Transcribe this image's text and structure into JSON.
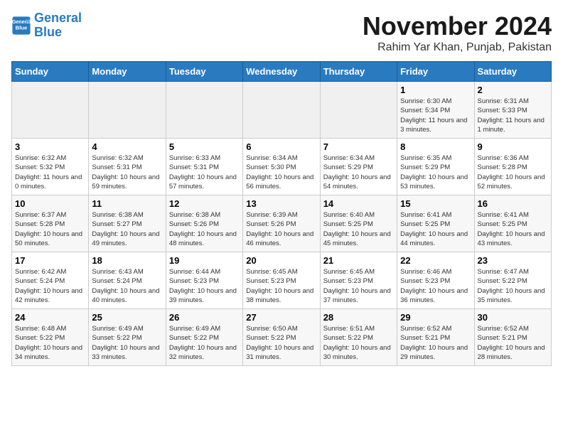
{
  "header": {
    "logo_line1": "General",
    "logo_line2": "Blue",
    "month_title": "November 2024",
    "location": "Rahim Yar Khan, Punjab, Pakistan"
  },
  "weekdays": [
    "Sunday",
    "Monday",
    "Tuesday",
    "Wednesday",
    "Thursday",
    "Friday",
    "Saturday"
  ],
  "weeks": [
    [
      {
        "day": "",
        "info": ""
      },
      {
        "day": "",
        "info": ""
      },
      {
        "day": "",
        "info": ""
      },
      {
        "day": "",
        "info": ""
      },
      {
        "day": "",
        "info": ""
      },
      {
        "day": "1",
        "info": "Sunrise: 6:30 AM\nSunset: 5:34 PM\nDaylight: 11 hours\nand 3 minutes."
      },
      {
        "day": "2",
        "info": "Sunrise: 6:31 AM\nSunset: 5:33 PM\nDaylight: 11 hours\nand 1 minute."
      }
    ],
    [
      {
        "day": "3",
        "info": "Sunrise: 6:32 AM\nSunset: 5:32 PM\nDaylight: 11 hours\nand 0 minutes."
      },
      {
        "day": "4",
        "info": "Sunrise: 6:32 AM\nSunset: 5:31 PM\nDaylight: 10 hours\nand 59 minutes."
      },
      {
        "day": "5",
        "info": "Sunrise: 6:33 AM\nSunset: 5:31 PM\nDaylight: 10 hours\nand 57 minutes."
      },
      {
        "day": "6",
        "info": "Sunrise: 6:34 AM\nSunset: 5:30 PM\nDaylight: 10 hours\nand 56 minutes."
      },
      {
        "day": "7",
        "info": "Sunrise: 6:34 AM\nSunset: 5:29 PM\nDaylight: 10 hours\nand 54 minutes."
      },
      {
        "day": "8",
        "info": "Sunrise: 6:35 AM\nSunset: 5:29 PM\nDaylight: 10 hours\nand 53 minutes."
      },
      {
        "day": "9",
        "info": "Sunrise: 6:36 AM\nSunset: 5:28 PM\nDaylight: 10 hours\nand 52 minutes."
      }
    ],
    [
      {
        "day": "10",
        "info": "Sunrise: 6:37 AM\nSunset: 5:28 PM\nDaylight: 10 hours\nand 50 minutes."
      },
      {
        "day": "11",
        "info": "Sunrise: 6:38 AM\nSunset: 5:27 PM\nDaylight: 10 hours\nand 49 minutes."
      },
      {
        "day": "12",
        "info": "Sunrise: 6:38 AM\nSunset: 5:26 PM\nDaylight: 10 hours\nand 48 minutes."
      },
      {
        "day": "13",
        "info": "Sunrise: 6:39 AM\nSunset: 5:26 PM\nDaylight: 10 hours\nand 46 minutes."
      },
      {
        "day": "14",
        "info": "Sunrise: 6:40 AM\nSunset: 5:25 PM\nDaylight: 10 hours\nand 45 minutes."
      },
      {
        "day": "15",
        "info": "Sunrise: 6:41 AM\nSunset: 5:25 PM\nDaylight: 10 hours\nand 44 minutes."
      },
      {
        "day": "16",
        "info": "Sunrise: 6:41 AM\nSunset: 5:25 PM\nDaylight: 10 hours\nand 43 minutes."
      }
    ],
    [
      {
        "day": "17",
        "info": "Sunrise: 6:42 AM\nSunset: 5:24 PM\nDaylight: 10 hours\nand 42 minutes."
      },
      {
        "day": "18",
        "info": "Sunrise: 6:43 AM\nSunset: 5:24 PM\nDaylight: 10 hours\nand 40 minutes."
      },
      {
        "day": "19",
        "info": "Sunrise: 6:44 AM\nSunset: 5:23 PM\nDaylight: 10 hours\nand 39 minutes."
      },
      {
        "day": "20",
        "info": "Sunrise: 6:45 AM\nSunset: 5:23 PM\nDaylight: 10 hours\nand 38 minutes."
      },
      {
        "day": "21",
        "info": "Sunrise: 6:45 AM\nSunset: 5:23 PM\nDaylight: 10 hours\nand 37 minutes."
      },
      {
        "day": "22",
        "info": "Sunrise: 6:46 AM\nSunset: 5:23 PM\nDaylight: 10 hours\nand 36 minutes."
      },
      {
        "day": "23",
        "info": "Sunrise: 6:47 AM\nSunset: 5:22 PM\nDaylight: 10 hours\nand 35 minutes."
      }
    ],
    [
      {
        "day": "24",
        "info": "Sunrise: 6:48 AM\nSunset: 5:22 PM\nDaylight: 10 hours\nand 34 minutes."
      },
      {
        "day": "25",
        "info": "Sunrise: 6:49 AM\nSunset: 5:22 PM\nDaylight: 10 hours\nand 33 minutes."
      },
      {
        "day": "26",
        "info": "Sunrise: 6:49 AM\nSunset: 5:22 PM\nDaylight: 10 hours\nand 32 minutes."
      },
      {
        "day": "27",
        "info": "Sunrise: 6:50 AM\nSunset: 5:22 PM\nDaylight: 10 hours\nand 31 minutes."
      },
      {
        "day": "28",
        "info": "Sunrise: 6:51 AM\nSunset: 5:22 PM\nDaylight: 10 hours\nand 30 minutes."
      },
      {
        "day": "29",
        "info": "Sunrise: 6:52 AM\nSunset: 5:21 PM\nDaylight: 10 hours\nand 29 minutes."
      },
      {
        "day": "30",
        "info": "Sunrise: 6:52 AM\nSunset: 5:21 PM\nDaylight: 10 hours\nand 28 minutes."
      }
    ]
  ]
}
